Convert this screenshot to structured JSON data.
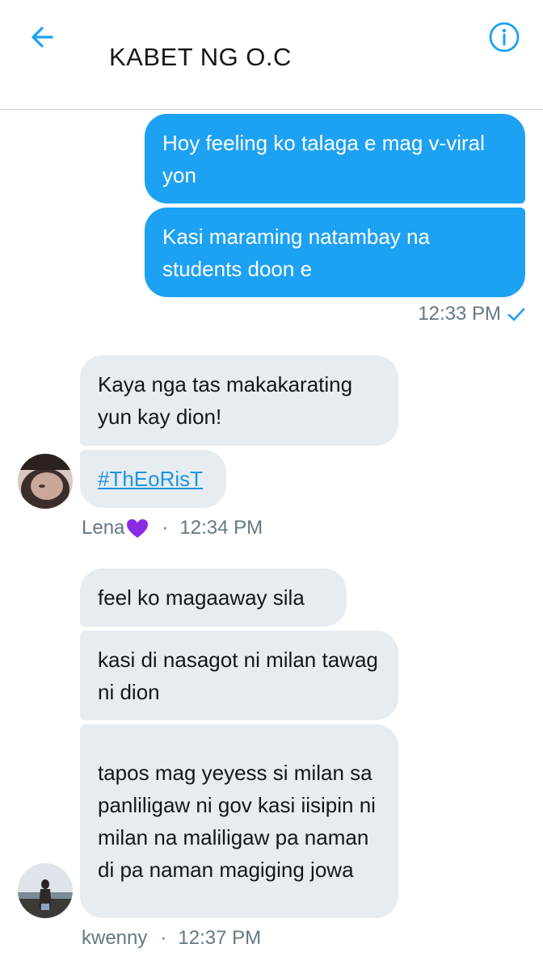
{
  "header": {
    "title": "KABET NG O.C",
    "back_icon": "arrow-left-icon",
    "info_icon": "info-icon",
    "accent_color": "#1da1f2"
  },
  "outgoing": {
    "messages": [
      "Hoy feeling ko talaga e mag v-viral yon",
      "Kasi maraming natambay na students doon e"
    ],
    "time": "12:33 PM",
    "status_icon": "checkmark-icon"
  },
  "lena": {
    "messages": [
      "Kaya nga tas makakarating yun kay dion!"
    ],
    "hashtag": "#ThEoRisT",
    "name": "Lena",
    "name_emoji": "purple-heart-icon",
    "dot": "·",
    "time": "12:34 PM"
  },
  "kwenny": {
    "messages": [
      "feel ko magaaway sila",
      "kasi di nasagot ni milan tawag ni dion",
      "tapos mag yeyess si milan sa panliligaw ni gov kasi iisipin ni milan na maliligaw pa naman di pa naman magiging jowa"
    ],
    "name": "kwenny",
    "dot": "·",
    "time": "12:37 PM"
  }
}
